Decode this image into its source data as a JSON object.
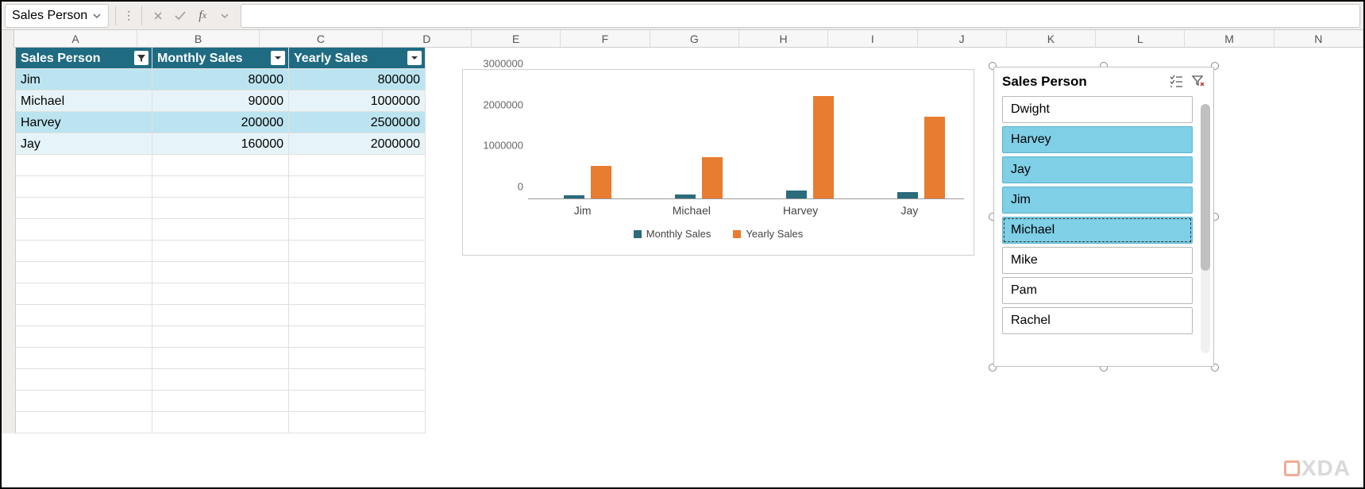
{
  "name_box": "Sales Person",
  "columns": [
    "A",
    "B",
    "C",
    "D",
    "E",
    "F",
    "G",
    "H",
    "I",
    "J",
    "K",
    "L",
    "M",
    "N"
  ],
  "table": {
    "headers": [
      "Sales Person",
      "Monthly Sales",
      "Yearly Sales"
    ],
    "rows": [
      {
        "person": "Jim",
        "monthly": "80000",
        "yearly": "800000"
      },
      {
        "person": "Michael",
        "monthly": "90000",
        "yearly": "1000000"
      },
      {
        "person": "Harvey",
        "monthly": "200000",
        "yearly": "2500000"
      },
      {
        "person": "Jay",
        "monthly": "160000",
        "yearly": "2000000"
      }
    ]
  },
  "chart_data": {
    "type": "bar",
    "categories": [
      "Jim",
      "Michael",
      "Harvey",
      "Jay"
    ],
    "series": [
      {
        "name": "Monthly Sales",
        "values": [
          80000,
          90000,
          200000,
          160000
        ],
        "color": "#2a6b7c"
      },
      {
        "name": "Yearly Sales",
        "values": [
          800000,
          1000000,
          2500000,
          2000000
        ],
        "color": "#e87c30"
      }
    ],
    "yticks": [
      0,
      1000000,
      2000000,
      3000000
    ],
    "ylim": [
      0,
      3000000
    ],
    "title": "",
    "xlabel": "",
    "ylabel": ""
  },
  "slicer": {
    "title": "Sales Person",
    "items": [
      {
        "label": "Dwight",
        "selected": false
      },
      {
        "label": "Harvey",
        "selected": true
      },
      {
        "label": "Jay",
        "selected": true
      },
      {
        "label": "Jim",
        "selected": true
      },
      {
        "label": "Michael",
        "selected": true,
        "active": true
      },
      {
        "label": "Mike",
        "selected": false
      },
      {
        "label": "Pam",
        "selected": false
      },
      {
        "label": "Rachel",
        "selected": false
      }
    ]
  },
  "watermark": "XDA"
}
